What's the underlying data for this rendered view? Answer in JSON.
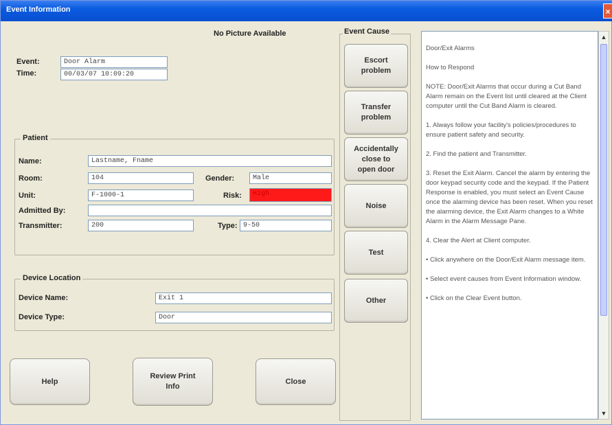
{
  "window": {
    "title": "Event Information",
    "close_glyph": "×"
  },
  "picture": {
    "text": "No Picture Available"
  },
  "event": {
    "event_label": "Event:",
    "event_value": "Door Alarm",
    "time_label": "Time:",
    "time_value": "00/03/07 10:09:20"
  },
  "patient": {
    "group_title": "Patient",
    "name_label": "Name:",
    "name_value": "Lastname, Fname",
    "room_label": "Room:",
    "room_value": "104",
    "gender_label": "Gender:",
    "gender_value": "Male",
    "unit_label": "Unit:",
    "unit_value": "F-1000-1",
    "risk_label": "Risk:",
    "risk_value": "High",
    "admitted_label": "Admitted By:",
    "admitted_value": "",
    "transmitter_label": "Transmitter:",
    "transmitter_value": "200",
    "type_label": "Type:",
    "type_value": "9-50",
    "risk_color": "#ff1a1a"
  },
  "device": {
    "group_title": "Device Location",
    "name_label": "Device Name:",
    "name_value": "Exit 1",
    "type_label": "Device Type:",
    "type_value": "Door"
  },
  "buttons": {
    "help": "Help",
    "review_print": "Review Print\nInfo",
    "close": "Close"
  },
  "event_cause": {
    "title": "Event Cause",
    "options": [
      "Escort\nproblem",
      "Transfer\nproblem",
      "Accidentally\nclose to\nopen door",
      "Noise",
      "Test",
      "Other"
    ]
  },
  "instructions": {
    "paragraphs": [
      "Door/Exit Alarms",
      "How to Respond",
      "NOTE: Door/Exit Alarms that occur during a Cut Band Alarm remain on the Event list until cleared at the Client computer until the Cut Band Alarm is cleared.",
      "1. Always follow your facility's policies/procedures to ensure patient safety and security.",
      "2. Find the patient and Transmitter.",
      "3. Reset the Exit Alarm. Cancel the alarm by entering the door keypad security code and the keypad. If the Patient Response is enabled, you must select an Event Cause once the alarming device has been reset. When you reset the alarming device, the Exit Alarm changes to a White Alarm in the Alarm Message Pane.",
      "4. Clear the Alert at Client computer.",
      "• Click anywhere on the Door/Exit Alarm message item.",
      "• Select event causes from Event Information window.",
      "• Click on the Clear Event button."
    ]
  }
}
